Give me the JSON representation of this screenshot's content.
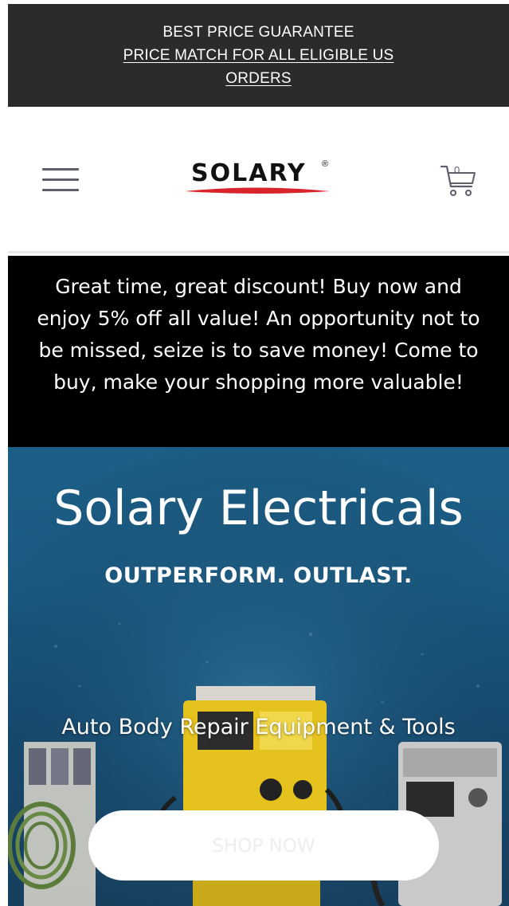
{
  "announcement": {
    "line1": "BEST PRICE GUARANTEE",
    "link": "PRICE MATCH FOR ALL ELIGIBLE US ORDERS"
  },
  "header": {
    "logo_text": "SOLARY",
    "logo_reg": "®",
    "cart_count": "0",
    "menu_icon": "hamburger-menu-icon",
    "cart_icon": "shopping-cart-icon"
  },
  "promo": {
    "text": "Great time, great discount! Buy now and enjoy 5% off all value! An opportunity not to be missed, seize is to save money! Come to buy, make your shopping more valuable!"
  },
  "hero": {
    "title": "Solary Electricals",
    "tagline": "OUTPERFORM. OUTLAST.",
    "category": "Auto Body Repair Equipment & Tools",
    "cta_label": "SHOP NOW"
  },
  "colors": {
    "announcement_bg": "#2b2b2b",
    "promo_bg": "#000000",
    "hero_bg": "#1b5a82",
    "logo_accent": "#d8242a",
    "icon_gray": "#5f5f6a"
  }
}
